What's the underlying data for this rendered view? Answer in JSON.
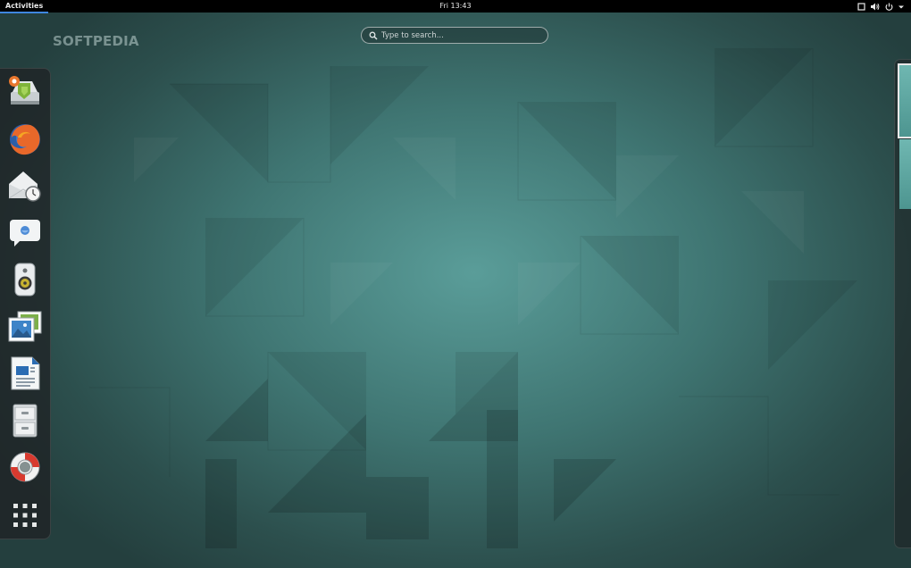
{
  "topbar": {
    "activities_label": "Activities",
    "clock": "Fri 13:43",
    "tray_icons": [
      "window-icon",
      "volume-icon",
      "power-icon",
      "chevron-down-icon"
    ]
  },
  "overlay": {
    "logo_text": "SOFTPEDIA"
  },
  "search": {
    "placeholder": "Type to search..."
  },
  "dash": {
    "items": [
      {
        "name": "software-install-icon"
      },
      {
        "name": "firefox-icon"
      },
      {
        "name": "evolution-mail-icon"
      },
      {
        "name": "empathy-chat-icon"
      },
      {
        "name": "rhythmbox-speaker-icon"
      },
      {
        "name": "shotwell-photos-icon"
      },
      {
        "name": "libreoffice-writer-icon"
      },
      {
        "name": "file-cabinet-icon"
      },
      {
        "name": "help-lifebuoy-icon"
      },
      {
        "name": "show-applications-icon"
      }
    ]
  },
  "workspaces": {
    "count": 2,
    "active_index": 0
  },
  "colors": {
    "topbar_bg": "#000000",
    "activities_underline": "#3f86e0",
    "wallpaper_center": "#5a9d99",
    "wallpaper_edge": "#243f3e"
  }
}
